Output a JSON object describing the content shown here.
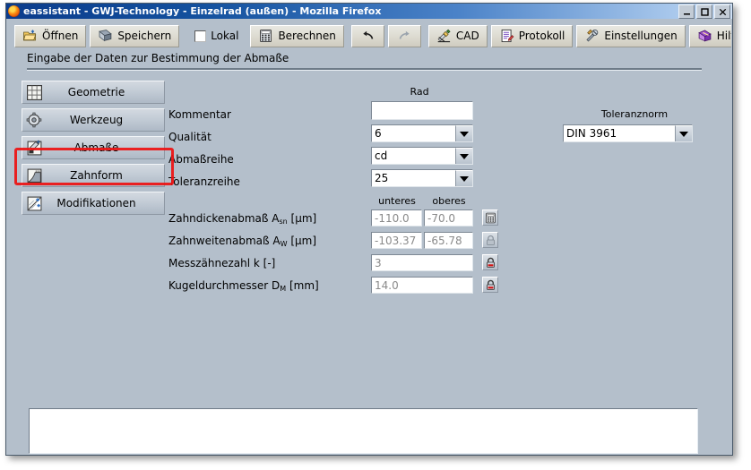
{
  "window": {
    "title": "eassistant - GWJ-Technology - Einzelrad (außen) - Mozilla Firefox",
    "minimize": "_",
    "maximize": "□",
    "close": "✕"
  },
  "toolbar": [
    {
      "label": "Öffnen",
      "icon": "open-folder-icon"
    },
    {
      "label": "Speichern",
      "icon": "floppy-disk-icon"
    },
    {
      "label": "Lokal",
      "icon": "checkbox-icon"
    },
    {
      "label": "Berechnen",
      "icon": "calculator-icon"
    },
    {
      "label": "",
      "icon": "undo-icon"
    },
    {
      "label": "",
      "icon": "redo-icon"
    },
    {
      "label": "CAD",
      "icon": "cad-pencil-icon"
    },
    {
      "label": "Protokoll",
      "icon": "report-icon"
    },
    {
      "label": "Einstellungen",
      "icon": "settings-tools-icon"
    },
    {
      "label": "Hilfe",
      "icon": "help-book-icon"
    }
  ],
  "page": {
    "header": "Eingabe der Daten zur Bestimmung der Abmaße"
  },
  "sidebar": {
    "items": [
      {
        "label": "Geometrie",
        "icon": "grid-table-icon"
      },
      {
        "label": "Werkzeug",
        "icon": "gear-tool-icon"
      },
      {
        "label": "Abmaße",
        "icon": "chart-pencil-icon"
      },
      {
        "label": "Zahnform",
        "icon": "tooth-profile-icon"
      },
      {
        "label": "Modifikationen",
        "icon": "modification-icon"
      }
    ]
  },
  "form": {
    "column_header": "Rad",
    "tolerance_header": "Toleranznorm",
    "tolerance_value": "DIN 3961",
    "sub_col_lower": "unteres",
    "sub_col_upper": "oberes",
    "rows": [
      {
        "label": "Kommentar",
        "value": ""
      },
      {
        "label": "Qualität",
        "value": "6"
      },
      {
        "label": "Abmaßreihe",
        "value": "cd"
      },
      {
        "label": "Toleranzreihe",
        "value": "25"
      }
    ],
    "measure_rows": [
      {
        "label_pre": "Zahndickenabmaß A",
        "sub": "sn",
        "label_post": " [µm]",
        "lower": "-110.0",
        "upper": "-70.0",
        "icon": "calculator-icon"
      },
      {
        "label_pre": "Zahnweitenabmaß A",
        "sub": "W",
        "label_post": " [µm]",
        "lower": "-103.37",
        "upper": "-65.78",
        "icon": "lock-open-gray-icon"
      },
      {
        "label_pre": "Messzähnezahl k [-]",
        "sub": "",
        "label_post": "",
        "single": "3",
        "icon": "lock-closed-red-icon"
      },
      {
        "label_pre": "Kugeldurchmesser D",
        "sub": "M",
        "label_post": " [mm]",
        "single": "14.0",
        "icon": "lock-closed-red-icon"
      }
    ]
  },
  "output": {
    "text": ""
  },
  "colors": {
    "window_bg": "#b4bfcb",
    "title_start": "#0b3c8c",
    "title_end": "#cfe0f5",
    "toolbar_btn": "#dedcd2",
    "annotation": "#ee1111",
    "lock_red": "#d01010"
  }
}
